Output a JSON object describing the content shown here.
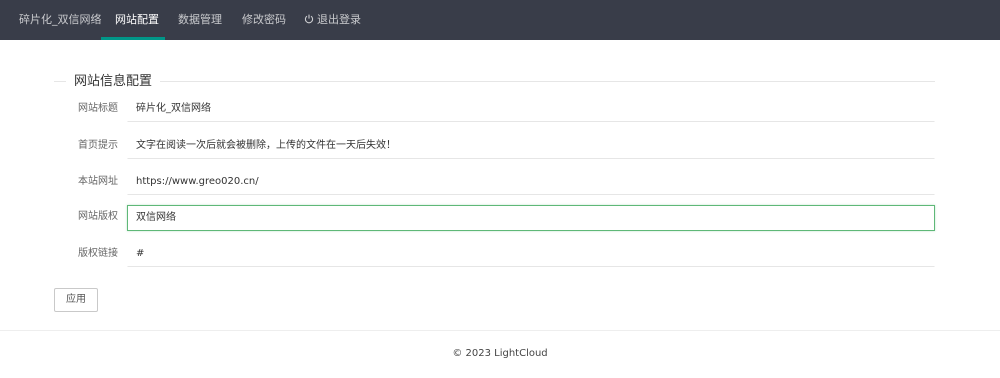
{
  "nav": {
    "brand": "碎片化_双信网络",
    "items": [
      {
        "label": "网站配置",
        "active": true
      },
      {
        "label": "数据管理",
        "active": false
      },
      {
        "label": "修改密码",
        "active": false
      },
      {
        "label": "退出登录",
        "active": false,
        "icon": "power-icon"
      }
    ],
    "active_color": "#009688",
    "background_color": "#393d49"
  },
  "form": {
    "legend": "网站信息配置",
    "fields": [
      {
        "label": "网站标题",
        "value": "碎片化_双信网络"
      },
      {
        "label": "首页提示",
        "value": "文字在阅读一次后就会被删除，上传的文件在一天后失效！"
      },
      {
        "label": "本站网址",
        "value": "https://www.greo020.cn/"
      },
      {
        "label": "网站版权",
        "value": "双信网络",
        "focused": true
      },
      {
        "label": "版权链接",
        "value": "#"
      }
    ],
    "submit_label": "应用"
  },
  "footer": {
    "copyright": "© 2023 LightCloud"
  }
}
